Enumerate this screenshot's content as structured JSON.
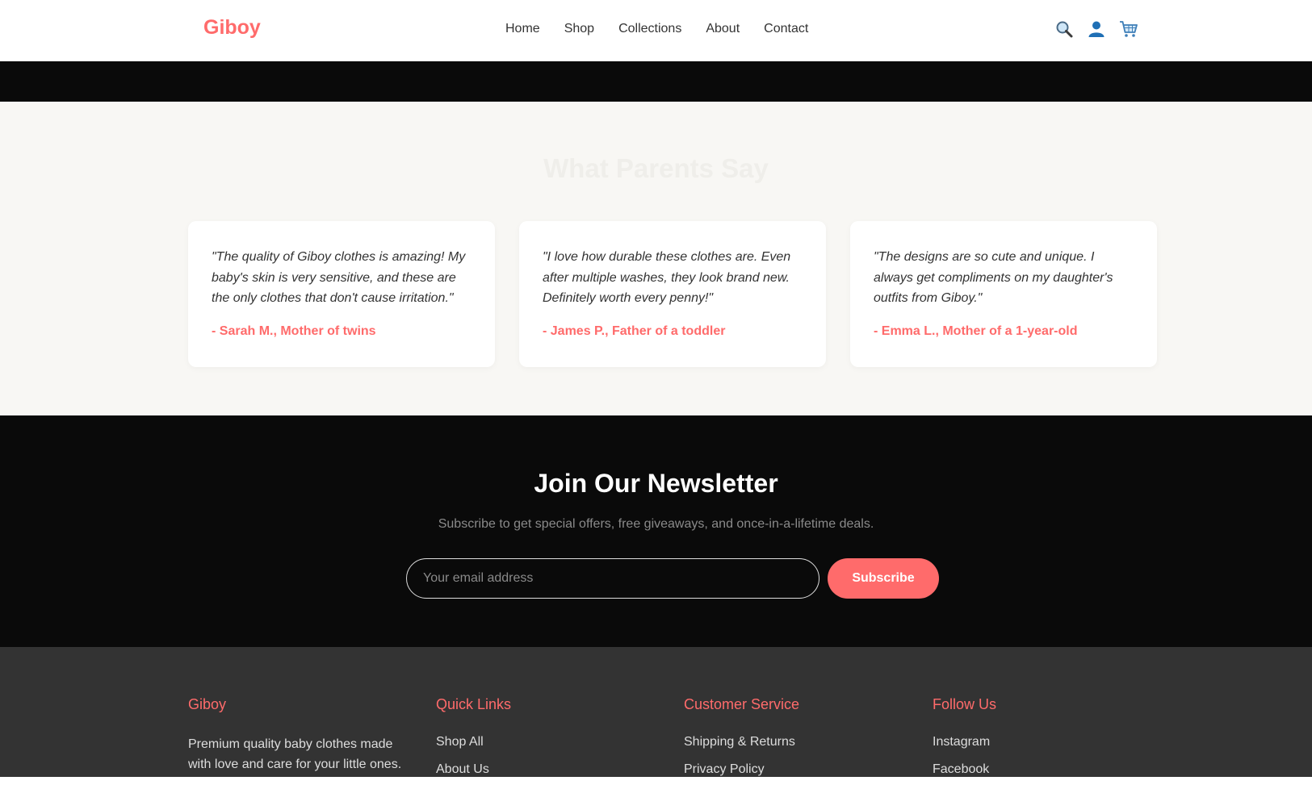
{
  "brand": {
    "name": "Giboy",
    "color": "#ff6b6b"
  },
  "nav": [
    "Home",
    "Shop",
    "Collections",
    "About",
    "Contact"
  ],
  "header_icons": [
    "search-icon",
    "user-icon",
    "cart-icon"
  ],
  "testimonials": {
    "title": "What Parents Say",
    "items": [
      {
        "quote": "\"The quality of Giboy clothes is amazing! My baby's skin is very sensitive, and these are the only clothes that don't cause irritation.\"",
        "author": "- Sarah M., Mother of twins"
      },
      {
        "quote": "\"I love how durable these clothes are. Even after multiple washes, they look brand new. Definitely worth every penny!\"",
        "author": "- James P., Father of a toddler"
      },
      {
        "quote": "\"The designs are so cute and unique. I always get compliments on my daughter's outfits from Giboy.\"",
        "author": "- Emma L., Mother of a 1-year-old"
      }
    ]
  },
  "newsletter": {
    "title": "Join Our Newsletter",
    "subtitle": "Subscribe to get special offers, free giveaways, and once-in-a-lifetime deals.",
    "placeholder": "Your email address",
    "button": "Subscribe"
  },
  "footer": {
    "about": {
      "heading": "Giboy",
      "text": "Premium quality baby clothes made with love and care for your little ones."
    },
    "quick_links": {
      "heading": "Quick Links",
      "items": [
        "Shop All",
        "About Us"
      ]
    },
    "customer_service": {
      "heading": "Customer Service",
      "items": [
        "Shipping & Returns",
        "Privacy Policy"
      ]
    },
    "follow_us": {
      "heading": "Follow Us",
      "items": [
        "Instagram",
        "Facebook"
      ]
    }
  }
}
